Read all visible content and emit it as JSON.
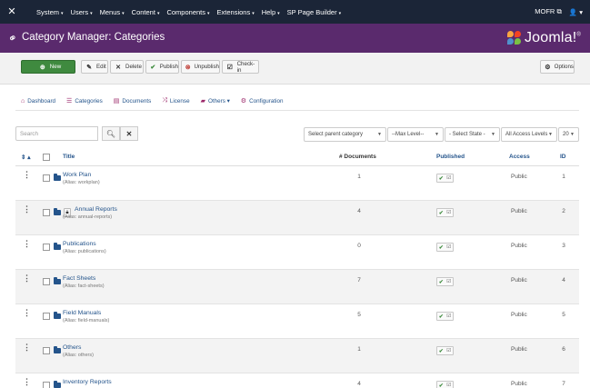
{
  "navbar": {
    "logo_icon": "joomla-icon",
    "menu": [
      {
        "label": "System",
        "caret": "▾"
      },
      {
        "label": "Users",
        "caret": "▾"
      },
      {
        "label": "Menus",
        "caret": "▾"
      },
      {
        "label": "Content",
        "caret": "▾"
      },
      {
        "label": "Components",
        "caret": "▾"
      },
      {
        "label": "Extensions",
        "caret": "▾"
      },
      {
        "label": "Help",
        "caret": "▾"
      },
      {
        "label": "SP Page Builder",
        "caret": "▾"
      }
    ],
    "site_name": "MOFR",
    "user_caret": "▾"
  },
  "header": {
    "title": "Category Manager: Categories",
    "brand": "Joomla!",
    "brand_sup": "®",
    "colors": {
      "bar": "#5a2a6d"
    }
  },
  "toolbar": {
    "new_label": "New",
    "edit_label": "Edit",
    "delete_label": "Delete",
    "publish_label": "Publish",
    "unpublish_label": "Unpublish",
    "checkin_label": "Check-in",
    "options_label": "Options"
  },
  "tabs": [
    {
      "label": "Dashboard",
      "icon": "home-icon"
    },
    {
      "label": "Categories",
      "icon": "list-icon"
    },
    {
      "label": "Documents",
      "icon": "document-icon"
    },
    {
      "label": "License",
      "icon": "shuffle-icon"
    },
    {
      "label": "Others ▾",
      "icon": "folder-icon"
    },
    {
      "label": "Configuration",
      "icon": "gear-icon"
    }
  ],
  "filters": {
    "search_placeholder": "Search",
    "parent_category": "Select parent category",
    "max_level": "--Max Level--",
    "state": "- Select State -",
    "access": "All Access Levels",
    "limit": "20"
  },
  "table": {
    "columns": {
      "sort": "⇕ ▴",
      "title": "Title",
      "documents": "# Documents",
      "published": "Published",
      "access": "Access",
      "id": "ID"
    },
    "rows": [
      {
        "title": "Work Plan",
        "alias": "(Alias: workplan)",
        "documents": "1",
        "access": "Public",
        "id": "1",
        "locked": false
      },
      {
        "title": "Annual Reports",
        "alias": "(Alias: annual-reports)",
        "documents": "4",
        "access": "Public",
        "id": "2",
        "locked": true
      },
      {
        "title": "Publications",
        "alias": "(Alias: publications)",
        "documents": "0",
        "access": "Public",
        "id": "3",
        "locked": false
      },
      {
        "title": "Fact Sheets",
        "alias": "(Alias: fact-sheets)",
        "documents": "7",
        "access": "Public",
        "id": "4",
        "locked": false
      },
      {
        "title": "Field Manuals",
        "alias": "(Alias: field-manuals)",
        "documents": "5",
        "access": "Public",
        "id": "5",
        "locked": false
      },
      {
        "title": "Others",
        "alias": "(Alias: others)",
        "documents": "1",
        "access": "Public",
        "id": "6",
        "locked": false
      },
      {
        "title": "Inventory Reports",
        "alias": "",
        "documents": "4",
        "access": "Public",
        "id": "7",
        "locked": false
      }
    ]
  }
}
